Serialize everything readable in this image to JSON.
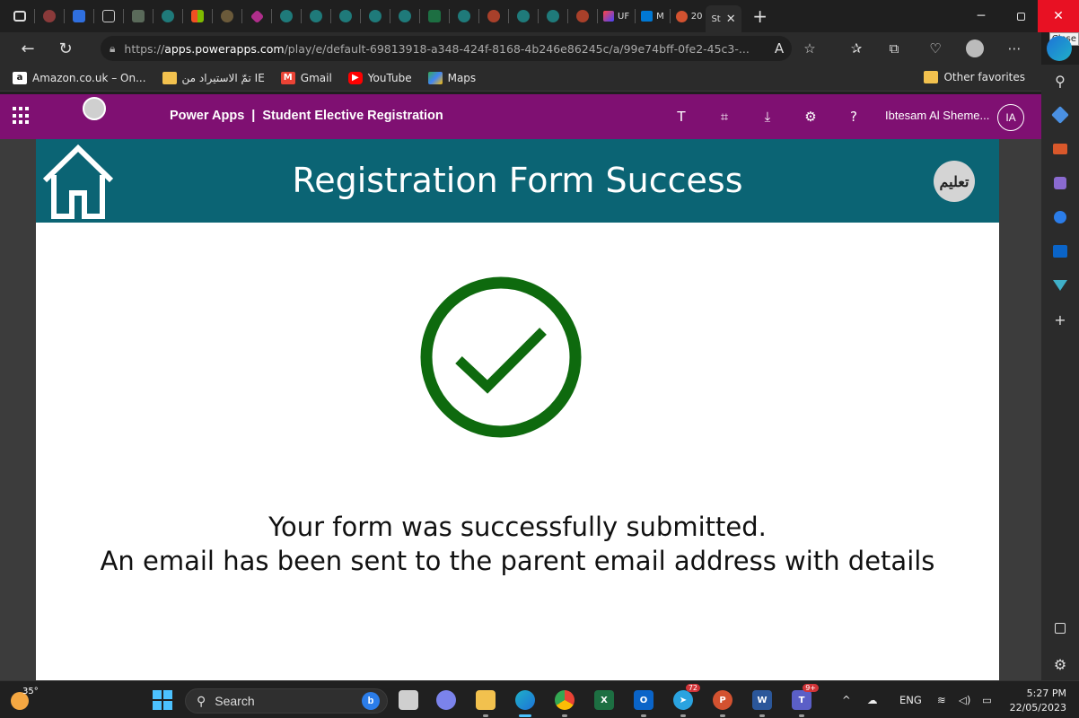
{
  "browser": {
    "tabs": {
      "active_label": "St",
      "other_labels": [
        "UF",
        "M",
        "20"
      ]
    },
    "close_tooltip": "Close",
    "url": {
      "prefix": "https://",
      "host": "apps.powerapps.com",
      "path": "/play/e/default-69813918-a348-424f-8168-4b246e86245c/a/99e74bff-0fe2-45c3-..."
    },
    "favorites": [
      {
        "label": "Amazon.co.uk – On...",
        "icon": "amazon-icon",
        "color": "#ffffff"
      },
      {
        "label": "تمّ الاستيراد من IE",
        "icon": "folder-icon",
        "color": "#f2c14e"
      },
      {
        "label": "Gmail",
        "icon": "gmail-icon",
        "color": "#ea4335"
      },
      {
        "label": "YouTube",
        "icon": "youtube-icon",
        "color": "#ff0000"
      },
      {
        "label": "Maps",
        "icon": "maps-icon",
        "color": "#34a853"
      }
    ],
    "other_favorites": "Other favorites"
  },
  "powerapps": {
    "product": "Power Apps",
    "separator": "|",
    "app_name": "Student Elective Registration",
    "user_name": "Ibtesam Al Sheme...",
    "user_initials": "IA",
    "header_color": "#7f1072"
  },
  "app": {
    "title": "Registration Form Success",
    "header_color": "#0b6474",
    "check_color": "#0e6a0e",
    "badge_text": "تعليم",
    "message_line1": "Your form was successfully submitted.",
    "message_line2": "An email has been sent to the parent email address with details"
  },
  "taskbar": {
    "weather_temp": "35°",
    "search_label": "Search",
    "badges": {
      "telegram": "72",
      "teams": "9+"
    },
    "lang": "ENG",
    "time": "5:27 PM",
    "date": "22/05/2023"
  }
}
